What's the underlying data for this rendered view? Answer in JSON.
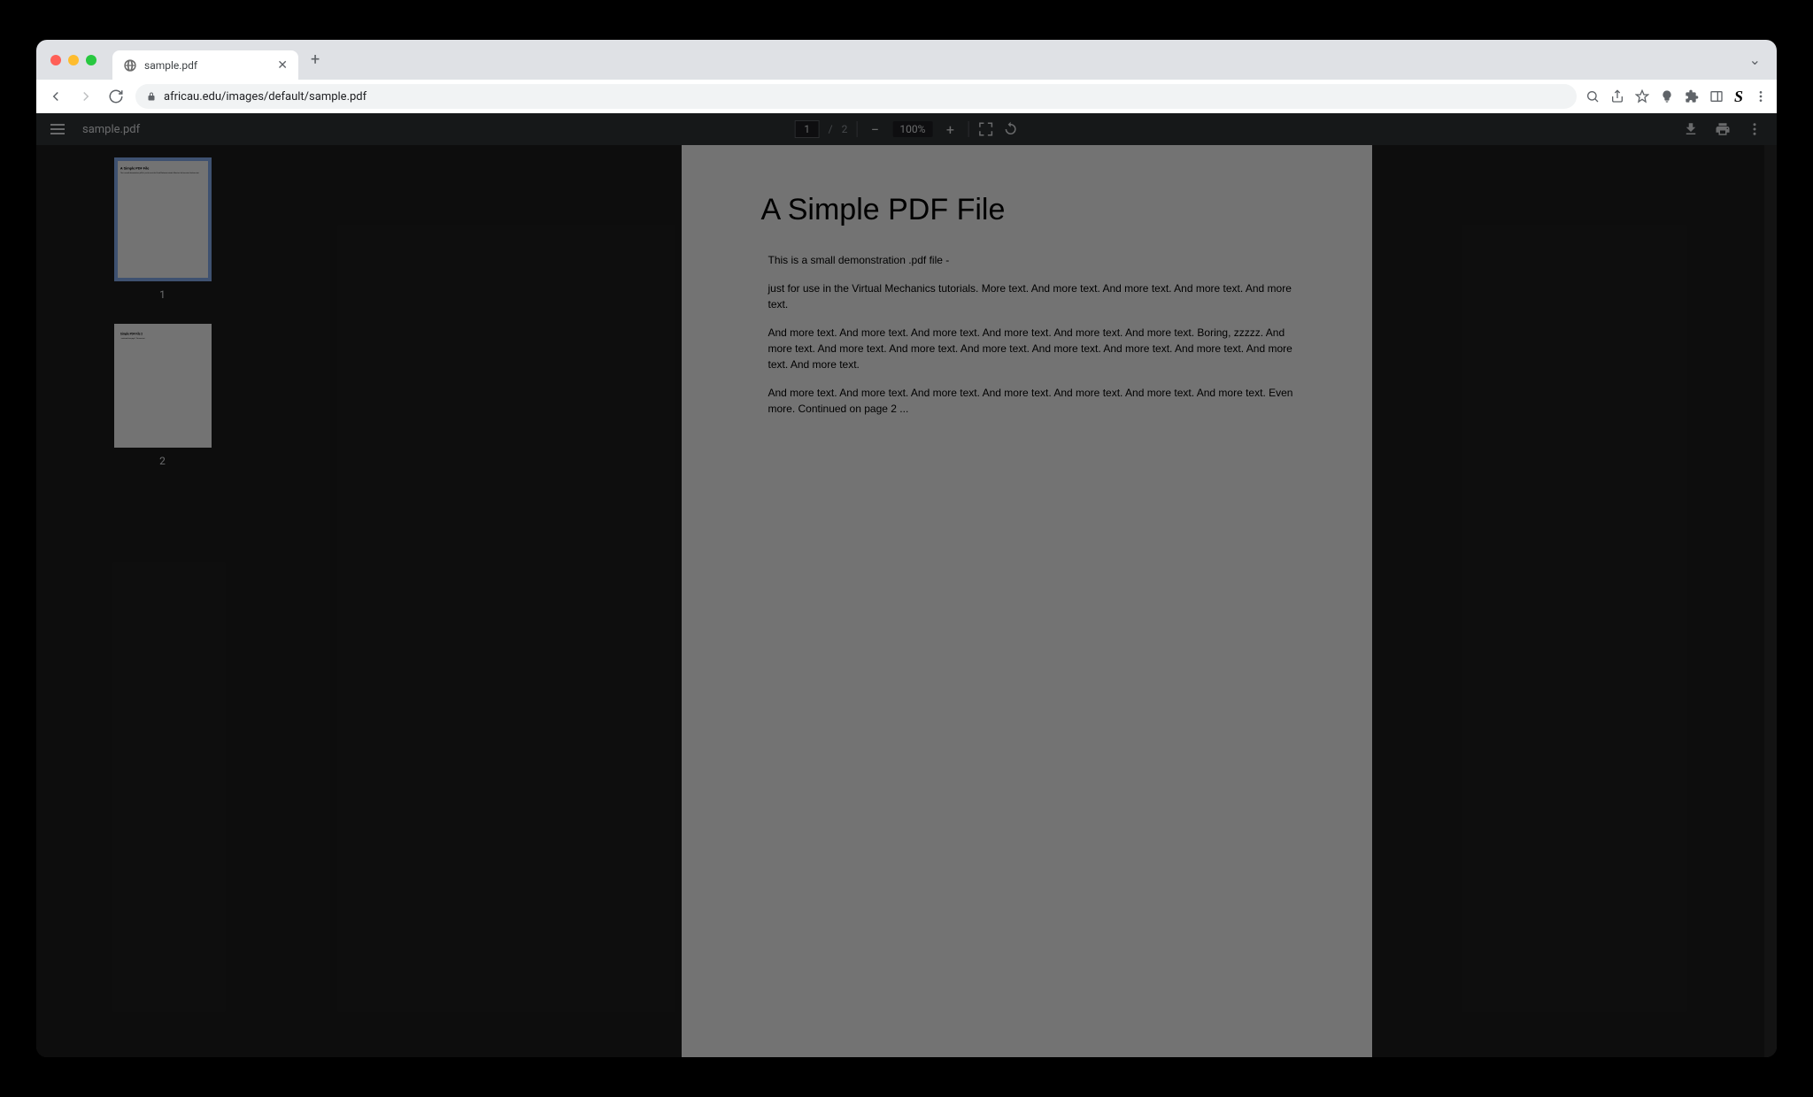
{
  "browser": {
    "tab_title": "sample.pdf",
    "url": "africau.edu/images/default/sample.pdf"
  },
  "pdf": {
    "filename": "sample.pdf",
    "current_page": "1",
    "page_separator": "/",
    "total_pages": "2",
    "zoom_level": "100%",
    "thumbnails": [
      {
        "label": "1",
        "active": true
      },
      {
        "label": "2",
        "active": false
      }
    ],
    "document": {
      "title": "A Simple PDF File",
      "paragraphs": [
        "This is a small demonstration .pdf file -",
        "just for use in the Virtual Mechanics tutorials. More text. And more text. And more text. And more text. And more text.",
        "And more text. And more text. And more text. And more text. And more text. And more text. Boring, zzzzz. And more text. And more text. And more text. And more text. And more text. And more text. And more text. And more text. And more text.",
        "And more text. And more text. And more text. And more text. And more text. And more text. And more text. Even more. Continued on page 2 ..."
      ]
    }
  }
}
